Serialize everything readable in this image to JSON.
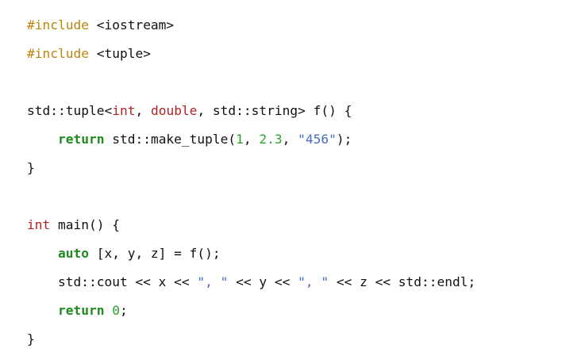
{
  "code": {
    "lines": [
      [
        {
          "t": "#include",
          "c": "include"
        },
        {
          "t": " <iostream>",
          "c": "plain"
        }
      ],
      [
        {
          "t": "#include",
          "c": "include"
        },
        {
          "t": " <tuple>",
          "c": "plain"
        }
      ],
      [],
      [
        {
          "t": "std::tuple<",
          "c": "plain"
        },
        {
          "t": "int",
          "c": "type"
        },
        {
          "t": ", ",
          "c": "plain"
        },
        {
          "t": "double",
          "c": "type"
        },
        {
          "t": ", std::string> f() {",
          "c": "plain"
        }
      ],
      [
        {
          "t": "    ",
          "c": "plain"
        },
        {
          "t": "return",
          "c": "kw"
        },
        {
          "t": " std::make_tuple(",
          "c": "plain"
        },
        {
          "t": "1",
          "c": "num"
        },
        {
          "t": ", ",
          "c": "plain"
        },
        {
          "t": "2.3",
          "c": "num"
        },
        {
          "t": ", ",
          "c": "plain"
        },
        {
          "t": "\"456\"",
          "c": "str"
        },
        {
          "t": ");",
          "c": "plain"
        }
      ],
      [
        {
          "t": "}",
          "c": "plain"
        }
      ],
      [],
      [
        {
          "t": "int",
          "c": "type"
        },
        {
          "t": " main() {",
          "c": "plain"
        }
      ],
      [
        {
          "t": "    ",
          "c": "plain"
        },
        {
          "t": "auto",
          "c": "kw"
        },
        {
          "t": " [x, y, z] = f();",
          "c": "plain"
        }
      ],
      [
        {
          "t": "    std::cout << x << ",
          "c": "plain"
        },
        {
          "t": "\", \"",
          "c": "str"
        },
        {
          "t": " << y << ",
          "c": "plain"
        },
        {
          "t": "\", \"",
          "c": "str"
        },
        {
          "t": " << z << std::endl;",
          "c": "plain"
        }
      ],
      [
        {
          "t": "    ",
          "c": "plain"
        },
        {
          "t": "return",
          "c": "kw"
        },
        {
          "t": " ",
          "c": "plain"
        },
        {
          "t": "0",
          "c": "num"
        },
        {
          "t": ";",
          "c": "plain"
        }
      ],
      [
        {
          "t": "}",
          "c": "plain"
        }
      ]
    ]
  }
}
